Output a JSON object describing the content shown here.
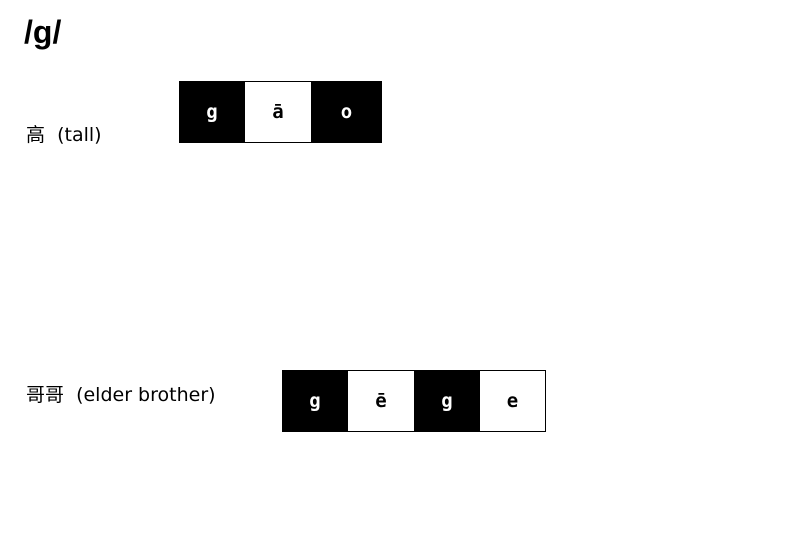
{
  "title": "/g/",
  "words": [
    {
      "label": "高  (tall)",
      "syllables": [
        {
          "text": "g",
          "style": "dark"
        },
        {
          "text": "ā",
          "style": "light"
        },
        {
          "text": "o",
          "style": "dark"
        }
      ]
    },
    {
      "label": "哥哥  (elder brother)",
      "syllables": [
        {
          "text": "g",
          "style": "dark"
        },
        {
          "text": "ē",
          "style": "light"
        },
        {
          "text": "g",
          "style": "dark"
        },
        {
          "text": "e",
          "style": "light"
        }
      ]
    }
  ],
  "colors": {
    "dark_tile": "#000000",
    "light_tile": "#ffffff",
    "text": "#000000"
  }
}
